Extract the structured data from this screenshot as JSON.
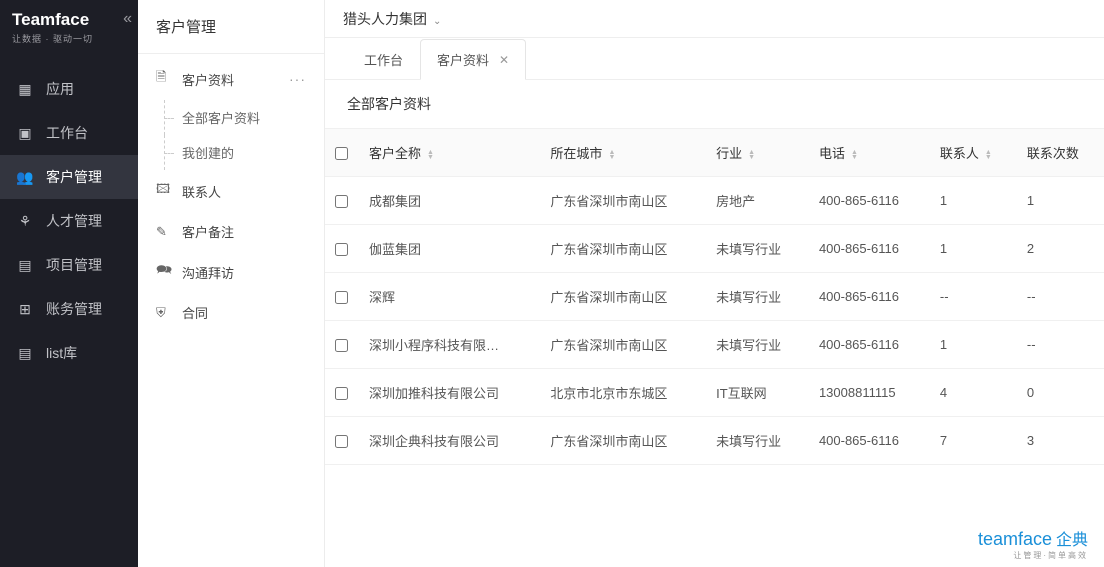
{
  "brand": {
    "title": "Teamface",
    "subtitle": "让数据 · 驱动一切"
  },
  "header": {
    "org": "猎头人力集团"
  },
  "nav": {
    "items": [
      {
        "label": "应用"
      },
      {
        "label": "工作台"
      },
      {
        "label": "客户管理"
      },
      {
        "label": "人才管理"
      },
      {
        "label": "项目管理"
      },
      {
        "label": "账务管理"
      },
      {
        "label": "list库"
      }
    ]
  },
  "subnav": {
    "title": "客户管理",
    "items": [
      {
        "label": "客户资料",
        "hasMore": true,
        "children": [
          {
            "label": "全部客户资料"
          },
          {
            "label": "我创建的"
          }
        ]
      },
      {
        "label": "联系人"
      },
      {
        "label": "客户备注"
      },
      {
        "label": "沟通拜访"
      },
      {
        "label": "合同"
      }
    ]
  },
  "tabs": [
    {
      "label": "工作台",
      "closable": false
    },
    {
      "label": "客户资料",
      "closable": true
    }
  ],
  "content": {
    "title": "全部客户资料",
    "columns": [
      "客户全称",
      "所在城市",
      "行业",
      "电话",
      "联系人",
      "联系次数"
    ],
    "rows": [
      {
        "c0": "成都集团",
        "c1": "广东省深圳市南山区",
        "c2": "房地产",
        "c3": "400-865-6116",
        "c4": "1",
        "c5": "1"
      },
      {
        "c0": "伽蓝集团",
        "c1": "广东省深圳市南山区",
        "c2": "未填写行业",
        "c3": "400-865-6116",
        "c4": "1",
        "c5": "2"
      },
      {
        "c0": "深辉",
        "c1": "广东省深圳市南山区",
        "c2": "未填写行业",
        "c3": "400-865-6116",
        "c4": "--",
        "c5": "--"
      },
      {
        "c0": "深圳小程序科技有限…",
        "c1": "广东省深圳市南山区",
        "c2": "未填写行业",
        "c3": "400-865-6116",
        "c4": "1",
        "c5": "--"
      },
      {
        "c0": "深圳加推科技有限公司",
        "c1": "北京市北京市东城区",
        "c2": "IT互联网",
        "c3": "13008811115",
        "c4": "4",
        "c5": "0"
      },
      {
        "c0": "深圳企典科技有限公司",
        "c1": "广东省深圳市南山区",
        "c2": "未填写行业",
        "c3": "400-865-6116",
        "c4": "7",
        "c5": "3"
      }
    ]
  },
  "footer": {
    "brand1": "teamface",
    "brand2": "企典",
    "sub": "让管理·简单高效"
  }
}
